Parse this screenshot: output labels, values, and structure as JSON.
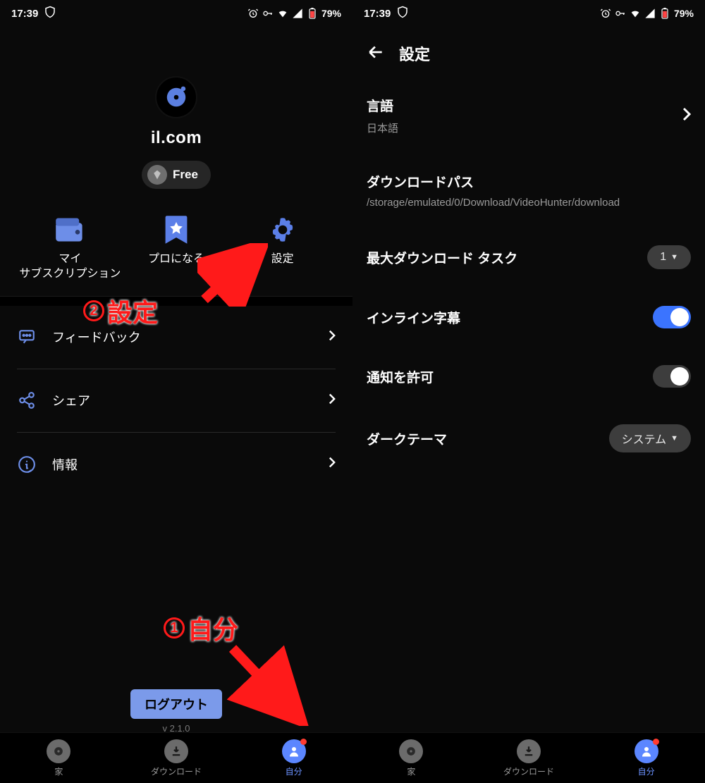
{
  "status": {
    "time": "17:39",
    "battery": "79%"
  },
  "left": {
    "email": "il.com",
    "badge": "Free",
    "tiles": {
      "subscription": "マイ\nサブスクリプション",
      "pro": "プロになる",
      "settings": "設定"
    },
    "list": {
      "feedback": "フィードバック",
      "share": "シェア",
      "info": "情報"
    },
    "logout": "ログアウト",
    "version": "v 2.1.0"
  },
  "right": {
    "title": "設定",
    "language": {
      "label": "言語",
      "value": "日本語"
    },
    "download_path": {
      "label": "ダウンロードパス",
      "value": "/storage/emulated/0/Download/VideoHunter/download"
    },
    "max_tasks": {
      "label": "最大ダウンロード タスク",
      "value": "1"
    },
    "inline_sub": {
      "label": "インライン字幕"
    },
    "notify": {
      "label": "通知を許可"
    },
    "dark_theme": {
      "label": "ダークテーマ",
      "value": "システム"
    }
  },
  "nav": {
    "home": "家",
    "download": "ダウンロード",
    "me": "自分"
  },
  "annotations": {
    "a1": "自分",
    "a2": "設定"
  }
}
